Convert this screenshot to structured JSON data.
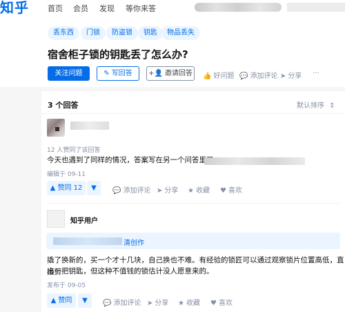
{
  "brand": {
    "logo": "知乎"
  },
  "nav": {
    "items": [
      "首页",
      "会员",
      "发现",
      "等你来答"
    ]
  },
  "question": {
    "tags": [
      "丢东西",
      "门锁",
      "防盗锁",
      "钥匙",
      "物品丢失"
    ],
    "title": "宿舍柜子锁的钥匙丢了怎么办?",
    "follow_label": "关注问题",
    "write_label": "写回答",
    "invite_label": "邀请回答",
    "good_label": "好问题",
    "comment_label": "添加评论",
    "share_label": "分享",
    "more_label": "···"
  },
  "answers_header": {
    "count": "3 个回答",
    "sort": "默认排序"
  },
  "answer1": {
    "approval": "12 人赞同了该回答",
    "text": "今天也遇到了同样的情况，答案写在另一个问答里了，",
    "edited": "编辑于 09-11",
    "vote_label": "▲ 赞同 12",
    "comment_label": "添加评论",
    "share_label": "分享",
    "favorite_label": "收藏",
    "like_label": "喜欢"
  },
  "answer2": {
    "author": "知乎用户",
    "notice_suffix": "清创作",
    "text_line1": "撬了换新的，买一个才十几块，自己换也不难。有经验的锁匠可以通过观察锁片位置高低，直接剪",
    "text_line2": "出一把钥匙，但这种不值钱的锁估计没人愿意来的。",
    "published": "发布于 09-05",
    "vote_label": "▲ 赞同",
    "comment_label": "添加评论",
    "share_label": "分享",
    "favorite_label": "收藏",
    "like_label": "喜欢"
  },
  "colors": {
    "accent": "#056de8",
    "muted": "#8590a6",
    "tag_bg": "#ebf5ff"
  }
}
